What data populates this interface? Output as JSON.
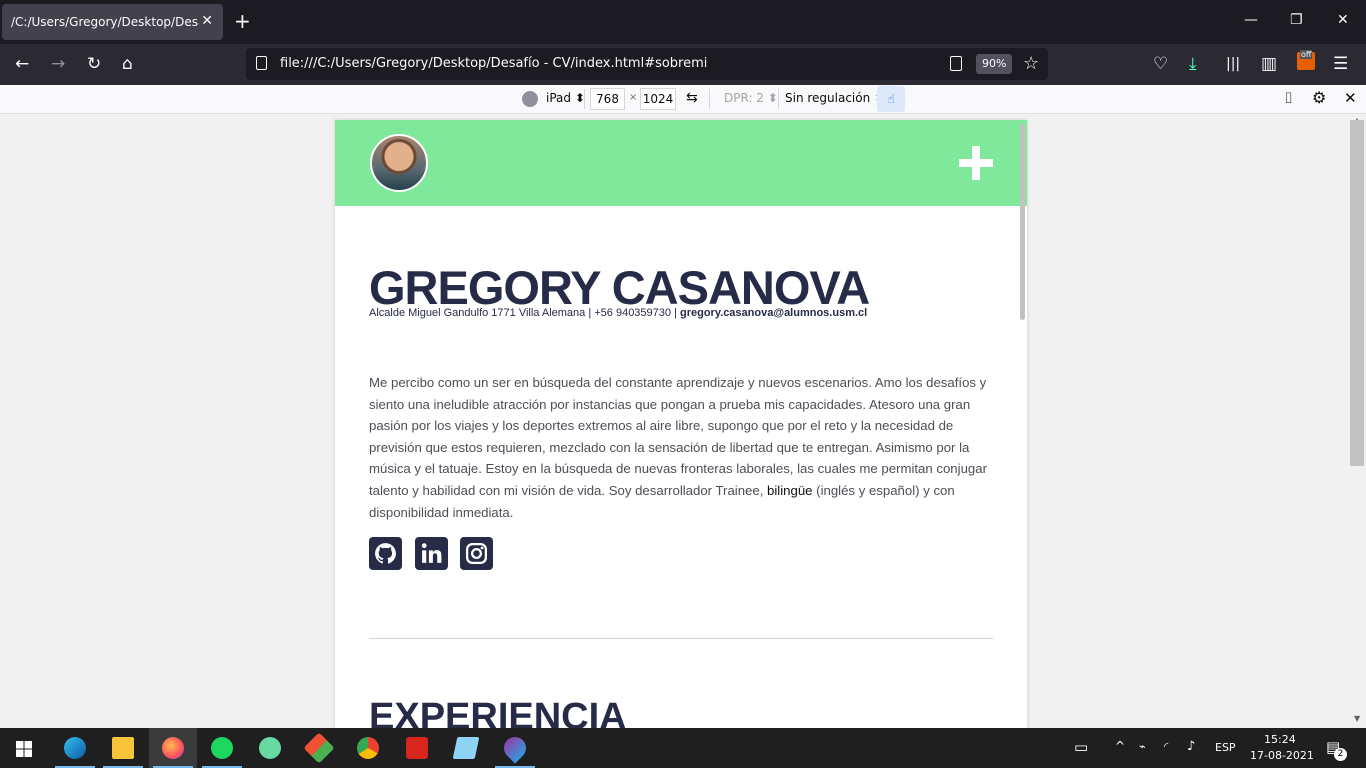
{
  "browser": {
    "tab_title": "/C:/Users/Gregory/Desktop/Desafío",
    "tab_close": "✕",
    "new_tab": "+",
    "url": "file:///C:/Users/Gregory/Desktop/Desafío - CV/index.html#sobremi",
    "zoom": "90%",
    "window_controls": {
      "minimize": "—",
      "restore": "❐",
      "close": "✕"
    },
    "extension_badge": "off"
  },
  "responsive_toolbar": {
    "device": "iPad",
    "width": "768",
    "times": "×",
    "height": "1024",
    "dpr": "DPR: 2",
    "throttling": "Sin regulación",
    "close": "✕"
  },
  "page": {
    "name": "GREGORY CASANOVA",
    "contact_plain": "Alcalde Miguel Gandulfo 1771 Villa Alemana | +56 940359730 | ",
    "contact_email": "gregory.casanova@alumnos.usm.cl",
    "bio_before": "Me percibo como un ser en búsqueda del constante aprendizaje y nuevos escenarios. Amo los desafíos y siento una ineludible atracción por instancias que pongan a prueba mis capacidades. Atesoro una gran pasión por los viajes y los deportes extremos al aire libre, supongo que por el reto y la necesidad de previsión que estos requieren, mezclado con la sensación de libertad que te entregan. Asimismo por la música y el tatuaje. Estoy en la búsqueda de nuevas fronteras laborales, las cuales me permitan conjugar talento y habilidad con mi visión de vida. Soy desarrollador Trainee, ",
    "bio_bold": "bilingüe",
    "bio_after": " (inglés y español) y con disponibilidad inmediata.",
    "section_experience": "EXPERIENCIA",
    "social_icons": [
      "github-icon",
      "linkedin-icon",
      "instagram-icon"
    ],
    "header_color": "#7fe89a",
    "text_color": "#262b47"
  },
  "taskbar": {
    "language": "ESP",
    "time": "15:24",
    "date": "17-08-2021",
    "notifications": "2"
  }
}
